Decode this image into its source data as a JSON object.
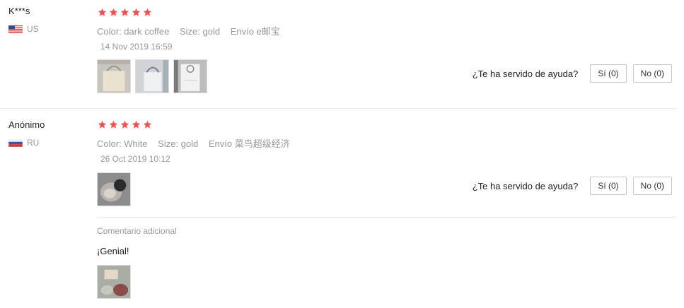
{
  "reviews": [
    {
      "user": "K***s",
      "country": "US",
      "color": "Color: dark coffee",
      "size": "Size: gold",
      "shipping": "Envío e邮宝",
      "date": "14 Nov 2019 16:59",
      "helpful_question": "¿Te ha servido de ayuda?",
      "yes_label": "Sí (0)",
      "no_label": "No (0)"
    },
    {
      "user": "Anónimo",
      "country": "RU",
      "color": "Color: White",
      "size": "Size: gold",
      "shipping": "Envío 菜鸟超级经济",
      "date": "26 Oct 2019 10:12",
      "helpful_question": "¿Te ha servido de ayuda?",
      "yes_label": "Sí (0)",
      "no_label": "No (0)",
      "additional_label": "Comentario adicional",
      "additional_text": "¡Genial!"
    }
  ],
  "rating": {
    "max": 5,
    "values": [
      5,
      5
    ]
  },
  "colors": {
    "star": "#f05050",
    "muted_text": "#999999",
    "divider": "#e8e8e8"
  }
}
